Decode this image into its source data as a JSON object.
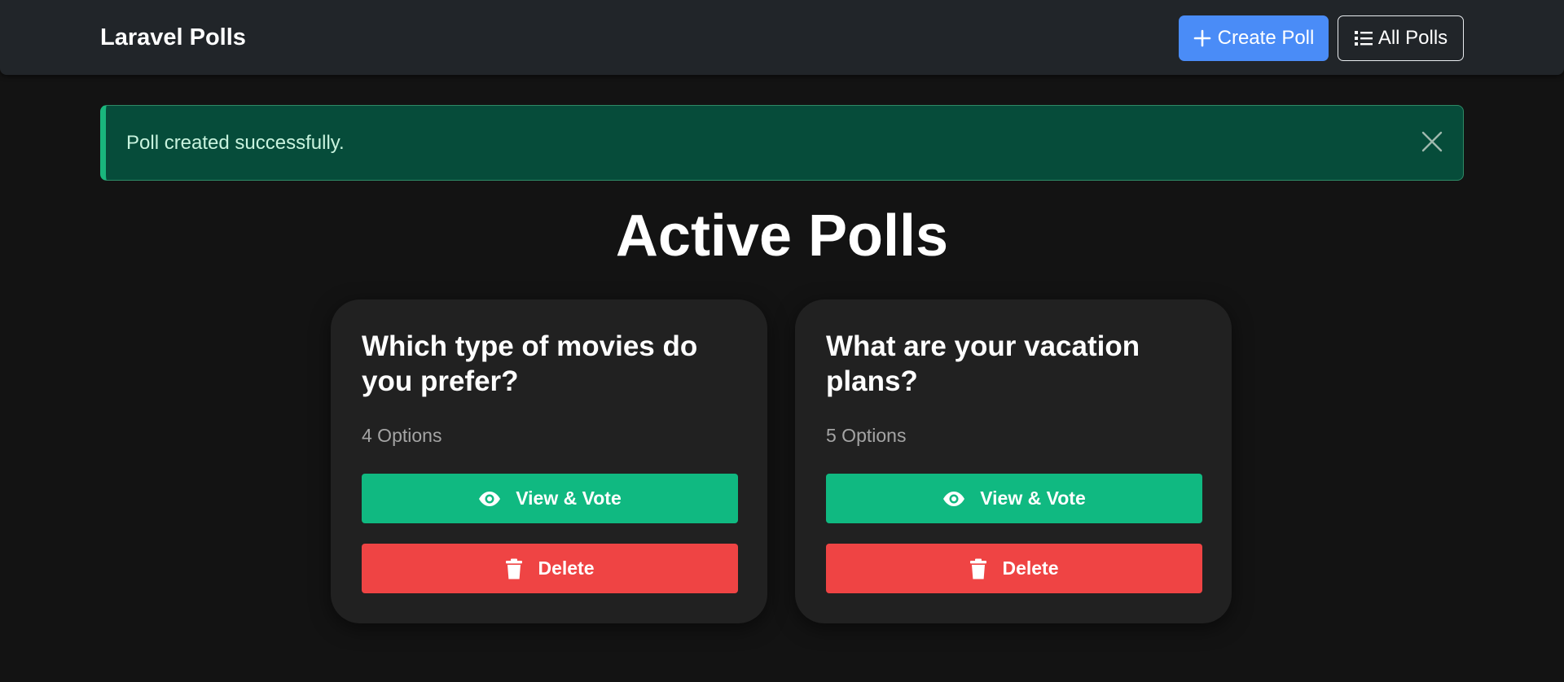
{
  "navbar": {
    "brand": "Laravel Polls",
    "create_label": "Create Poll",
    "all_label": "All Polls"
  },
  "alert": {
    "message": "Poll created successfully."
  },
  "page": {
    "title": "Active Polls"
  },
  "polls": [
    {
      "question": "Which type of movies do you prefer?",
      "options_count": "4 Options",
      "vote_label": "View & Vote",
      "delete_label": "Delete"
    },
    {
      "question": "What are your vacation plans?",
      "options_count": "5 Options",
      "vote_label": "View & Vote",
      "delete_label": "Delete"
    }
  ],
  "colors": {
    "background": "#131313",
    "navbar": "#212529",
    "primary": "#4a8cf7",
    "success": "#10b981",
    "danger": "#ef4444",
    "alert_bg": "#064c3a",
    "card": "#212121"
  },
  "icons": {
    "create": "plus-icon",
    "all": "list-icon",
    "close": "close-icon",
    "vote": "eye-icon",
    "delete": "trash-icon"
  }
}
